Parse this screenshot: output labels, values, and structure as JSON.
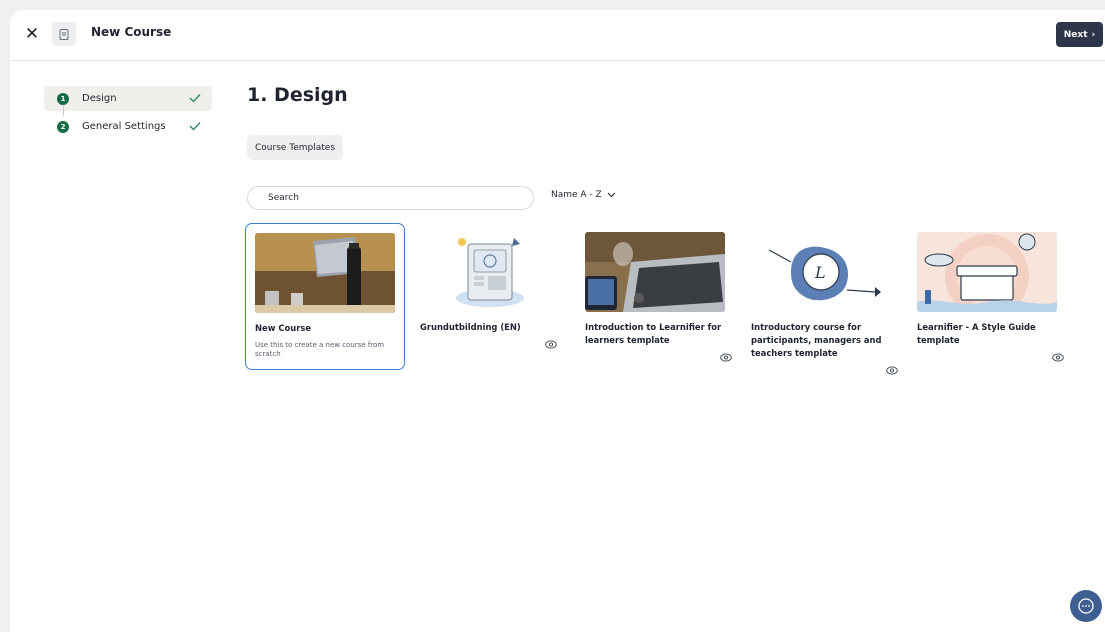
{
  "header": {
    "title": "New Course",
    "next_label": "Next",
    "next_arrow": "›"
  },
  "stepper": {
    "steps": [
      {
        "number": "1",
        "label": "Design",
        "completed": true,
        "active": true
      },
      {
        "number": "2",
        "label": "General Settings",
        "completed": true,
        "active": false
      }
    ]
  },
  "main": {
    "heading": "1. Design",
    "tab_label": "Course Templates",
    "search_placeholder": "Search",
    "sort_label": "Name A - Z"
  },
  "cards": [
    {
      "title": "New Course",
      "description": "Use this to create a new course from scratch",
      "selected": true
    },
    {
      "title": "Grundutbildning (EN)",
      "description": ""
    },
    {
      "title": "Introduction to Learnifier for learners template",
      "description": ""
    },
    {
      "title": "Introductory course for participants, managers and teachers template",
      "description": ""
    },
    {
      "title": "Learnifier - A Style Guide template",
      "description": ""
    }
  ],
  "colors": {
    "accent": "#3d7fd4",
    "step_green": "#176b46",
    "next_button": "#2e3749",
    "chat_button": "#3f5f93"
  },
  "icons": [
    "close-icon",
    "document-icon",
    "chevron-right-icon",
    "check-icon",
    "chevron-down-icon",
    "eye-icon",
    "chat-icon"
  ]
}
